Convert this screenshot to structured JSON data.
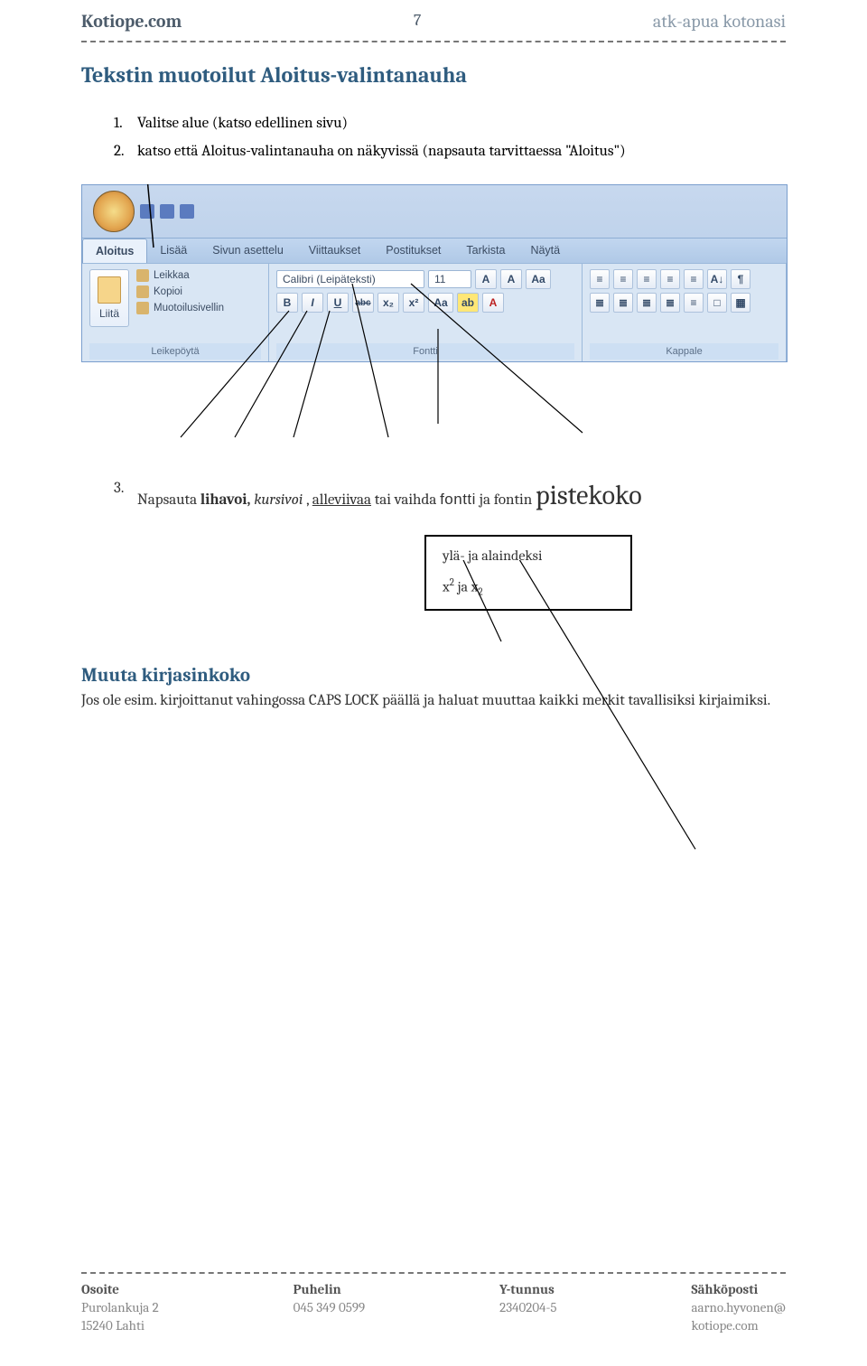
{
  "header": {
    "left": "Kotiope.com",
    "center": "7",
    "right": "atk-apua kotonasi"
  },
  "title": "Tekstin muotoilut Aloitus-valintanauha",
  "steps": [
    "Valitse alue (katso edellinen sivu)",
    "katso että Aloitus-valintanauha on näkyvissä (napsauta tarvittaessa \"Aloitus\")"
  ],
  "ribbon": {
    "tabs": [
      "Aloitus",
      "Lisää",
      "Sivun asettelu",
      "Viittaukset",
      "Postitukset",
      "Tarkista",
      "Näytä"
    ],
    "groups": {
      "clipboard": "Leikepöytä",
      "font": "Fontti",
      "paragraph": "Kappale"
    },
    "clipboard": {
      "paste": "Liitä",
      "cut": "Leikkaa",
      "copy": "Kopioi",
      "painter": "Muotoilusivellin"
    },
    "font": {
      "name": "Calibri (Leipäteksti)",
      "size": "11",
      "B": "B",
      "I": "I",
      "U": "U",
      "abc": "abc",
      "x2": "x₂",
      "x2b": "x²",
      "Aa": "Aa",
      "ab": "ab",
      "A1": "A",
      "A2": "A",
      "Agrow": "A",
      "Ashrink": "A"
    },
    "para": {
      "b1": "≡",
      "b2": "≡",
      "b3": "≡",
      "b4": "≡",
      "b5": "≡",
      "b6": "≡",
      "b7": "≡",
      "b8": "A↓",
      "b9": "¶",
      "c1": "≣",
      "c2": "≣",
      "c3": "≣",
      "c4": "≣",
      "c5": "≡",
      "c6": "⋮",
      "c7": "□",
      "c8": "▦"
    }
  },
  "step3": {
    "num": "3.",
    "pre": "Napsauta ",
    "bold": "lihavoi,",
    "space1": " ",
    "italic": "kursivoi",
    "comma": ", ",
    "underline": "alleviivaa",
    "mid": " tai vaihda ",
    "fontti": "fontti",
    "post": " ja fontin ",
    "big": "pistekoko"
  },
  "calloutBox": {
    "line1": "ylä- ja alaindeksi",
    "x": "x",
    "sup": "2",
    "ja": "  ja  x",
    "sub": "2"
  },
  "section2": {
    "title": "Muuta kirjasinkoko",
    "text": "Jos ole esim. kirjoittanut vahingossa CAPS LOCK päällä ja haluat muuttaa kaikki merkit tavallisiksi kirjaimiksi."
  },
  "footer": {
    "cols": [
      {
        "label": "Osoite",
        "l1": "Purolankuja 2",
        "l2": "15240 Lahti"
      },
      {
        "label": "Puhelin",
        "l1": "045 349 0599",
        "l2": ""
      },
      {
        "label": "Y-tunnus",
        "l1": "2340204-5",
        "l2": ""
      },
      {
        "label": "Sähköposti",
        "l1": "aarno.hyvonen@",
        "l2": "kotiope.com"
      }
    ]
  }
}
